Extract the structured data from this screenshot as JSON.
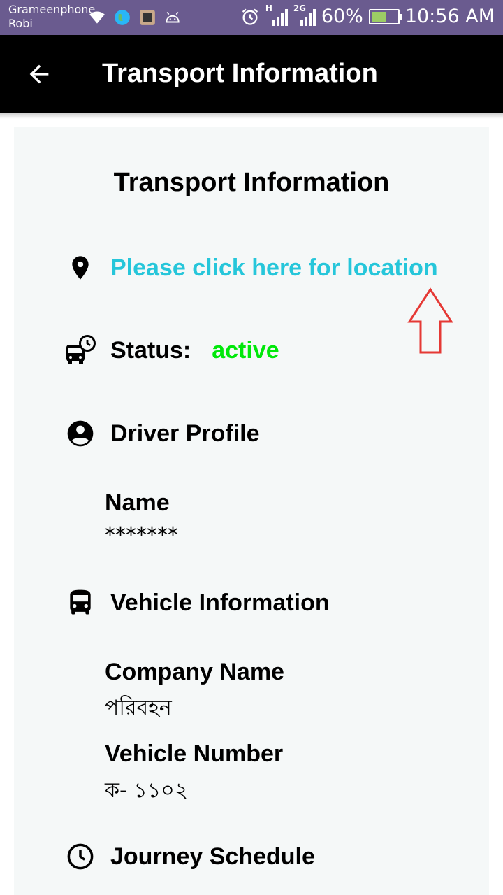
{
  "status_bar": {
    "carrier_1": "Grameenphone",
    "carrier_2": "Robi",
    "signal_1_tag": "H",
    "signal_2_tag": "2G",
    "battery_percent": "60%",
    "battery_level": 0.6,
    "time": "10:56 AM"
  },
  "app_bar": {
    "title": "Transport Information"
  },
  "card": {
    "title": "Transport Information",
    "location_link": "Please click here for location",
    "status_label": "Status:",
    "status_value": "active",
    "driver_section": "Driver Profile",
    "name_label": "Name",
    "name_value": "*******",
    "vehicle_section": "Vehicle Information",
    "company_label": "Company Name",
    "company_value": "পরিবহন",
    "vehicle_number_label": "Vehicle Number",
    "vehicle_number_value": "ক- ১১০২",
    "schedule_section": "Journey Schedule"
  },
  "colors": {
    "app_bar": "#000000",
    "status_bar": "#6a5b8f",
    "card": "#f5f8f8",
    "link": "#26c6da",
    "active": "#00e80a",
    "annotation_arrow": "#e53935"
  },
  "icons": [
    "back-arrow-icon",
    "location-pin-icon",
    "bus-clock-icon",
    "account-circle-icon",
    "bus-icon",
    "clock-icon"
  ]
}
